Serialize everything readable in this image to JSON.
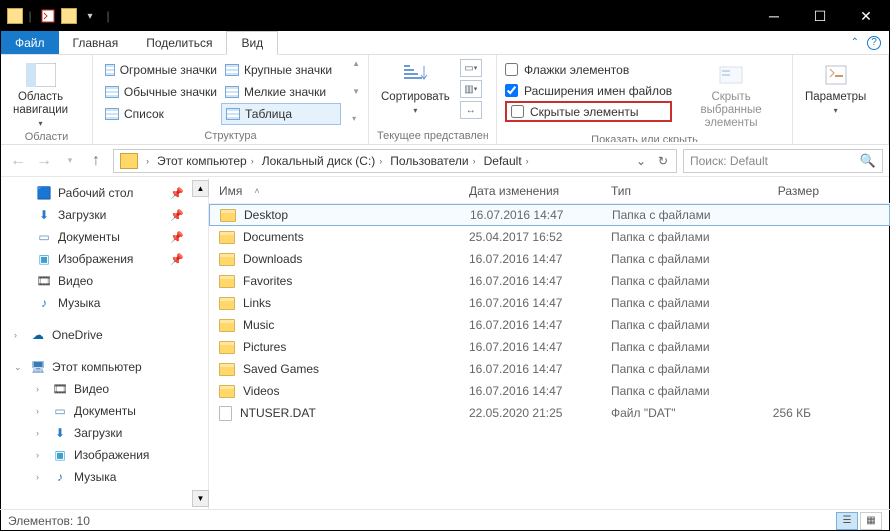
{
  "tabs": {
    "file": "Файл",
    "home": "Главная",
    "share": "Поделиться",
    "view": "Вид"
  },
  "ribbon": {
    "areas": {
      "nav_pane": "Область\nнавигации",
      "group": "Области"
    },
    "layout": {
      "huge": "Огромные значки",
      "large": "Крупные значки",
      "normal": "Обычные значки",
      "small": "Мелкие значки",
      "list": "Список",
      "table": "Таблица",
      "group": "Структура"
    },
    "current": {
      "sort": "Сортировать",
      "group": "Текущее представлен..."
    },
    "show": {
      "checkboxes": "Флажки элементов",
      "extensions": "Расширения имен файлов",
      "hidden": "Скрытые элементы",
      "hide_selected": "Скрыть выбранные\nэлементы",
      "group": "Показать или скрыть"
    },
    "options": "Параметры"
  },
  "breadcrumbs": [
    "Этот компьютер",
    "Локальный диск (C:)",
    "Пользователи",
    "Default"
  ],
  "search_placeholder": "Поиск: Default",
  "tree": {
    "desktop": "Рабочий стол",
    "downloads": "Загрузки",
    "documents": "Документы",
    "pictures": "Изображения",
    "videos": "Видео",
    "music": "Музыка",
    "onedrive": "OneDrive",
    "thispc": "Этот компьютер"
  },
  "columns": {
    "name": "Имя",
    "date": "Дата изменения",
    "type": "Тип",
    "size": "Размер"
  },
  "rows": [
    {
      "name": "Desktop",
      "date": "16.07.2016 14:47",
      "type": "Папка с файлами",
      "size": ""
    },
    {
      "name": "Documents",
      "date": "25.04.2017 16:52",
      "type": "Папка с файлами",
      "size": ""
    },
    {
      "name": "Downloads",
      "date": "16.07.2016 14:47",
      "type": "Папка с файлами",
      "size": ""
    },
    {
      "name": "Favorites",
      "date": "16.07.2016 14:47",
      "type": "Папка с файлами",
      "size": ""
    },
    {
      "name": "Links",
      "date": "16.07.2016 14:47",
      "type": "Папка с файлами",
      "size": ""
    },
    {
      "name": "Music",
      "date": "16.07.2016 14:47",
      "type": "Папка с файлами",
      "size": ""
    },
    {
      "name": "Pictures",
      "date": "16.07.2016 14:47",
      "type": "Папка с файлами",
      "size": ""
    },
    {
      "name": "Saved Games",
      "date": "16.07.2016 14:47",
      "type": "Папка с файлами",
      "size": ""
    },
    {
      "name": "Videos",
      "date": "16.07.2016 14:47",
      "type": "Папка с файлами",
      "size": ""
    },
    {
      "name": "NTUSER.DAT",
      "date": "22.05.2020 21:25",
      "type": "Файл \"DAT\"",
      "size": "256 КБ",
      "file": true
    }
  ],
  "status": "Элементов: 10"
}
